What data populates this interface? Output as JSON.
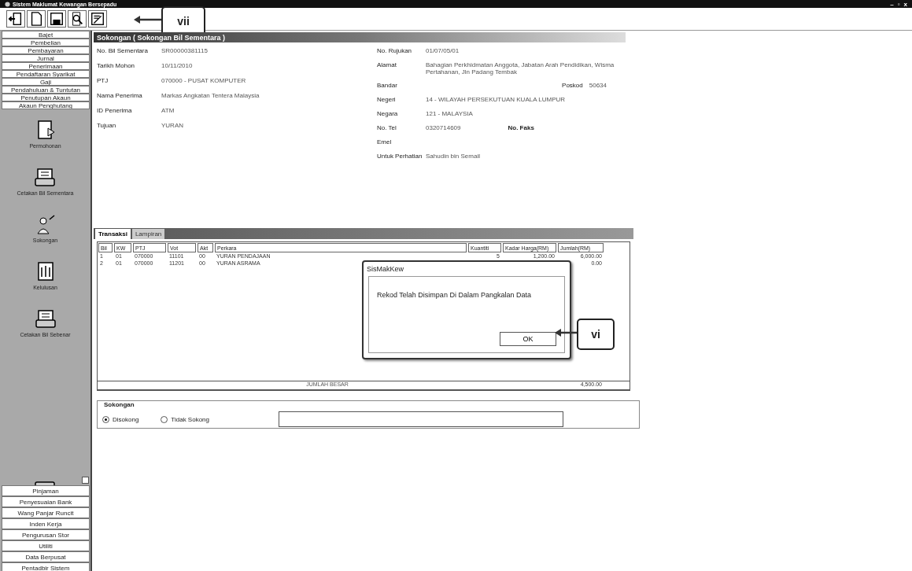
{
  "window": {
    "title": "Sistem Maklumat Kewangan Bersepadu",
    "controls": [
      "–",
      "▫",
      "x"
    ]
  },
  "toolbar": {
    "callout": "vii"
  },
  "sidebar": {
    "top_items": [
      "Bajet",
      "Pembelian",
      "Pembayaran",
      "Jurnal",
      "Penerimaan",
      "Pendaftaran Syarikat",
      "Gaji",
      "Pendahuluan & Tuntutan",
      "Penutupan Akaun",
      "Akaun Penghutang"
    ],
    "modules": [
      {
        "label": "Permohonan",
        "kind": "form"
      },
      {
        "label": "Cetakan Bil Sementara",
        "kind": "print"
      },
      {
        "label": "Sokongan",
        "kind": "people"
      },
      {
        "label": "Kelulusan",
        "kind": "approve"
      },
      {
        "label": "Cetakan Bil Sebenar",
        "kind": "print"
      }
    ],
    "bottom_items": [
      "Pinjaman",
      "Penyesuaian Bank",
      "Wang Panjar Runcit",
      "Inden Kerja",
      "Pengurusan Stor",
      "Utiliti",
      "Data Berpusat",
      "Pentadbir Sistem"
    ]
  },
  "form": {
    "title": "Sokongan ( Sokongan Bil Sementara )",
    "left_fields": [
      {
        "label": "No. Bil Sementara",
        "value": "SR00000381115"
      },
      {
        "label": "Tarikh Mohon",
        "value": "10/11/2010"
      },
      {
        "label": "PTJ",
        "value": "070000 - PUSAT KOMPUTER"
      },
      {
        "label": "Nama Penerima",
        "value": "Markas Angkatan Tentera Malaysia"
      },
      {
        "label": "ID Penerima",
        "value": "ATM"
      },
      {
        "label": "Tujuan",
        "value": "YURAN"
      }
    ],
    "right_fields": [
      {
        "label": "No. Rujukan",
        "value": "01/07/05/01"
      },
      {
        "label": "Alamat",
        "value": "Bahagian Perkhidmatan Anggota, Jabatan Arah Pendidikan, Wisma Pertahanan, Jln Padang Tembak"
      },
      {
        "label": "Bandar",
        "extra_label": "Poskod",
        "extra_value": "50634"
      },
      {
        "label": "Negeri",
        "value": "14 - WILAYAH PERSEKUTUAN KUALA LUMPUR"
      },
      {
        "label": "Negara",
        "value": "121 - MALAYSIA"
      },
      {
        "label": "No. Tel",
        "value": "0320714609",
        "extra_label": "No. Faks"
      },
      {
        "label": "Emel"
      },
      {
        "label": "Untuk Perhatian",
        "value": "Sahudin bin Semail"
      }
    ]
  },
  "tabs": [
    {
      "label": "Transaksi",
      "selected": true
    },
    {
      "label": "Lampiran",
      "selected": false
    }
  ],
  "table": {
    "columns": [
      "Bil",
      "KW",
      "PTJ",
      "Vot",
      "Akt",
      "Perkara",
      "Kuantiti",
      "Kadar Harga(RM)",
      "Jumlah(RM)"
    ],
    "rows": [
      [
        "1",
        "01",
        "070000",
        "11101",
        "00",
        "YURAN PENDAJAAN",
        "5",
        "1,200.00",
        "6,000.00"
      ],
      [
        "2",
        "01",
        "070000",
        "11201",
        "00",
        "YURAN ASRAMA",
        "",
        "",
        "0.00"
      ]
    ],
    "total_label": "JUMLAH BESAR",
    "total": "4,500.00"
  },
  "sokongan": {
    "title": "Sokongan",
    "options": [
      {
        "label": "Disokong",
        "selected": true
      },
      {
        "label": "Tidak Sokong",
        "selected": false
      }
    ]
  },
  "dialog": {
    "title": "SisMakKew",
    "message": "Rekod Telah Disimpan Di Dalam Pangkalan Data",
    "button": "OK",
    "callout": "vi"
  }
}
